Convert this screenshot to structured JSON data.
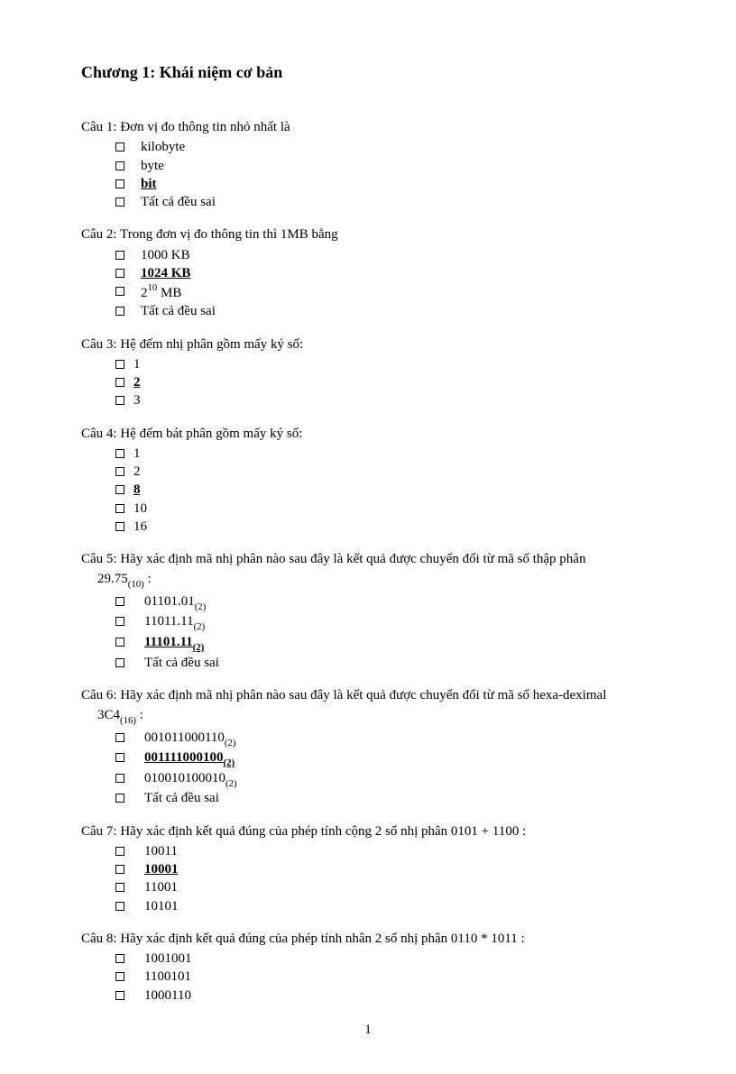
{
  "chapter_title": "Chương 1: Khái niệm cơ bản",
  "page_number": "1",
  "questions": [
    {
      "label": "Câu 1",
      "text": "Đơn vị đo thông tin nhỏ nhất là",
      "options": [
        {
          "text": "kilobyte",
          "correct": false
        },
        {
          "text": "byte",
          "correct": false
        },
        {
          "text": "bit",
          "correct": true
        },
        {
          "text": "Tất cả đều sai",
          "correct": false
        }
      ]
    },
    {
      "label": "Câu 2",
      "text": "Trong đơn vị đo thông tin thì  1MB bằng",
      "options": [
        {
          "text": "1000 KB",
          "correct": false
        },
        {
          "text": "1024 KB",
          "correct": true
        },
        {
          "html": "2<span class=\"sup\">10</span> MB",
          "correct": false
        },
        {
          "text": "Tất cả đều sai",
          "correct": false
        }
      ]
    },
    {
      "label": "Câu 3",
      "text": "Hệ đếm nhị phân gồm mấy ký số:",
      "opt_class": "opt-narrow",
      "options": [
        {
          "text": "1",
          "correct": false
        },
        {
          "text": "2",
          "correct": true
        },
        {
          "text": "3",
          "correct": false
        }
      ]
    },
    {
      "label": "Câu 4",
      "text": "Hệ đếm bát phân  gồm mấy ký số:",
      "opt_class": "opt-narrow",
      "options": [
        {
          "text": "1",
          "correct": false
        },
        {
          "text": "2",
          "correct": false
        },
        {
          "text": "8",
          "correct": true
        },
        {
          "text": "10",
          "correct": false
        },
        {
          "text": "16",
          "correct": false
        }
      ]
    },
    {
      "label": "Câu 5",
      "text": "Hãy xác định mã nhị phân nào sau đây là kết quả được chuyển đổi từ mã số thập phân",
      "text2_html": "29.75<span class=\"sub\">(10)</span> :",
      "opt_class": "opt-wide",
      "options": [
        {
          "html": "01101.01<span class=\"sub\">(2)</span>",
          "correct": false
        },
        {
          "html": "11011.11<span class=\"sub\">(2)</span>",
          "correct": false
        },
        {
          "html": "11101.11<span class=\"sub correct\">(2)</span>",
          "correct": true,
          "html_correct": "<span class=\"correct\">11101.11</span><span class=\"sub correct\">(2)</span>"
        },
        {
          "text": "Tất cả đều sai",
          "correct": false
        }
      ]
    },
    {
      "label": "Câu 6",
      "text": "Hãy xác định mã nhị phân nào sau đây là kết quả được chuyển đổi từ mã số hexa-deximal",
      "text2_html": "3C4<span class=\"sub\">(16)</span> :",
      "opt_class": "opt-wide",
      "options": [
        {
          "html": "001011000110<span class=\"sub\">(2)</span>",
          "correct": false
        },
        {
          "html_correct": "<span class=\"correct\">001111000100</span><span class=\"sub correct\">(2)</span>",
          "correct": true
        },
        {
          "html": "010010100010<span class=\"sub\">(2)</span>",
          "correct": false
        },
        {
          "text": "Tất cả đều sai",
          "correct": false
        }
      ]
    },
    {
      "label": "Câu 7",
      "text": "Hãy xác định kết quả đúng của phép tính cộng 2 số nhị phân  0101 + 1100 :",
      "opt_class": "opt-wide",
      "options": [
        {
          "text": "10011",
          "correct": false
        },
        {
          "text": "10001",
          "correct": true
        },
        {
          "text": "11001",
          "correct": false
        },
        {
          "text": "10101",
          "correct": false
        }
      ]
    },
    {
      "label": "Câu 8",
      "text": "Hãy xác định kết quả đúng của phép tính nhân 2 số nhị phân 0110 * 1011 :",
      "opt_class": "opt-wide",
      "options": [
        {
          "text": "1001001",
          "correct": false
        },
        {
          "text": "1100101",
          "correct": false
        },
        {
          "text": "1000110",
          "correct": false
        }
      ]
    }
  ]
}
